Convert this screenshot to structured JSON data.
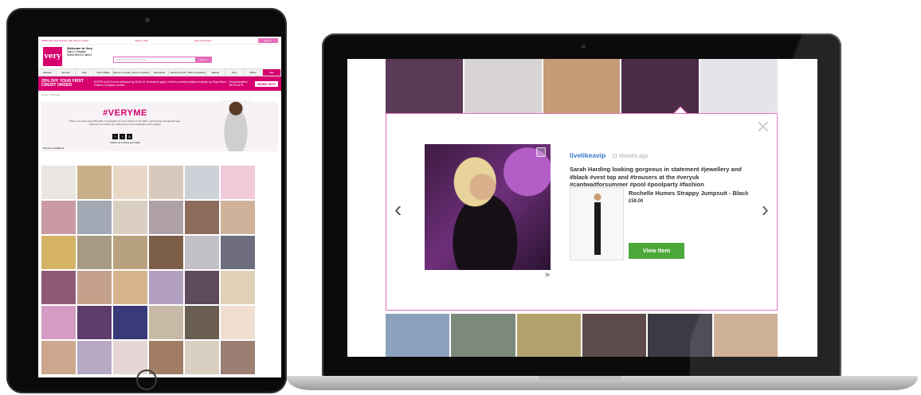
{
  "tablet": {
    "topbar": {
      "free_delivery": "FREE Next Day Delivery with Click & Collect",
      "ways_to_pay": "Ways to Pay",
      "new_customers": "New Customers",
      "sign_in": "Sign In"
    },
    "header": {
      "logo_text": "very",
      "welcome_title": "Welcome to Very",
      "welcome_sub": "Sign in | Register",
      "saved_items": "Saved items (0 items)",
      "search_placeholder": "Search or enter item number",
      "search_button": "Search"
    },
    "nav": [
      "Lifestyle",
      "Women",
      "Men",
      "Kids & Baby",
      "Sports & Leisure",
      "Home & Garden",
      "Electricals",
      "Gaming & DVD",
      "Gifts & Jewellery",
      "Beauty",
      "Toys",
      "Offers",
      "Sale"
    ],
    "promo": {
      "headline": "20% OFF YOUR FIRST CREDIT ORDER",
      "details": "ENTER KUK19 at the checkout by 26.02.16. Exclusions apply. Credit is provided subject to status, by Shop Direct Finance Company Limited.",
      "apr": "Representative 39.9% APR",
      "more_info": "MORE INFO"
    },
    "breadcrumb": "Home > #VeryMe",
    "hero": {
      "title": "#VERYME",
      "text": "Share your style using #VeryMe on Instagram for your chance to win £50 in quick treats and appear here. Discover how others are styling Very in our shoppable online gallery",
      "follow": "Follow us & Show your style",
      "terms": "Terms & Conditions"
    }
  },
  "modal": {
    "username": "livelikeavip",
    "time": "11 Months ago",
    "caption": "Sarah Harding looking gorgeous in statement #jewellery and #black #vest top and #trousers at the #veryuk #cantwaitforsummer #pool #poolparty #fashion",
    "product_name": "Rochelle Humes Strappy Jumpsuit - Black",
    "price": "£59.00",
    "view_button": "View Item",
    "close_glyph": "✕",
    "prev_glyph": "‹",
    "next_glyph": "›",
    "flag_glyph": "⚑"
  },
  "colors": {
    "brand_pink": "#d6006f",
    "accent_pink": "#e46dbb",
    "link_blue": "#3b78c7",
    "button_green": "#4ca83a"
  },
  "tablet_thumbs": [
    "#e9e5e0",
    "#c9b08a",
    "#e9d8c8",
    "#d7c9bc",
    "#cdd2d8",
    "#f2c9d8",
    "#c99aa5",
    "#a2a8b4",
    "#dbcfc2",
    "#b0a1a8",
    "#8d6c5c",
    "#d0b29a",
    "#d4b366",
    "#a79a84",
    "#b8a27e",
    "#7c5e48",
    "#c4c0c8",
    "#6d6d7d",
    "#8f5a78",
    "#c5a08a",
    "#d5b38c",
    "#b3a0c0",
    "#5e4a5c",
    "#e0d0b5",
    "#d49cc4",
    "#5f3b6e",
    "#3a3a7a",
    "#c7b9a6",
    "#6a5e52",
    "#f0dfd0",
    "#cda78d",
    "#b7a8c4",
    "#e7d6d6",
    "#a07d64",
    "#d9d0c2",
    "#9c7f73"
  ],
  "laptop_top_thumbs": [
    "#5b3a57",
    "#d8d4d4",
    "#c49c78",
    "#4b2b48",
    "#e6e4ea"
  ],
  "laptop_bottom_thumbs": [
    "#8aa2bd",
    "#7b8a7a",
    "#b3a26b",
    "#5d4a4a",
    "#3d3a45",
    "#c8a88b"
  ]
}
